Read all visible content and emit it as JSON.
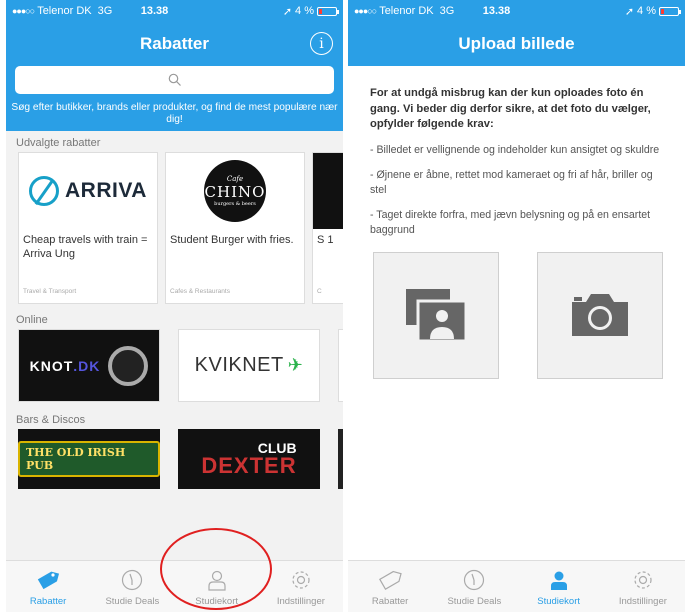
{
  "left": {
    "status": {
      "carrier": "Telenor DK",
      "network": "3G",
      "time": "13.38",
      "battery": "4 %"
    },
    "nav": {
      "title": "Rabatter",
      "info_glyph": "i"
    },
    "search": {
      "placeholder": "",
      "hint": "Søg efter butikker, brands eller produkter, og find de mest populære nær dig!"
    },
    "sections": {
      "featured": "Udvalgte rabatter",
      "online": "Online",
      "bars": "Bars & Discos"
    },
    "featured_cards": [
      {
        "logo": "ARRIVA",
        "title": "Cheap travels with train = Arriva Ung",
        "category": "Travel & Transport"
      },
      {
        "logo_line1": "Cafe",
        "logo_line2": "CHINO",
        "logo_line3": "burgers & beers",
        "title": "Student Burger with fries.",
        "category": "Cafes & Restaurants"
      }
    ],
    "featured_partial": {
      "title": "S 1",
      "category": "C"
    },
    "online_tiles": {
      "knot_prefix": "KNOT",
      "knot_suffix": ".DK",
      "kviknet": "KVIKNET"
    },
    "bar_tiles": {
      "irish": "THE OLD IRISH PUB",
      "club": "CLUB",
      "dexter": "DEXTER"
    },
    "tabs": [
      {
        "label": "Rabatter",
        "icon": "tag-icon",
        "active": true
      },
      {
        "label": "Studie Deals",
        "icon": "clock-icon",
        "active": false
      },
      {
        "label": "Studiekort",
        "icon": "user-icon",
        "active": false
      },
      {
        "label": "Indstillinger",
        "icon": "gear-icon",
        "active": false
      }
    ]
  },
  "right": {
    "status": {
      "carrier": "Telenor DK",
      "network": "3G",
      "time": "13.38",
      "battery": "4 %"
    },
    "nav": {
      "title": "Upload billede"
    },
    "intro": "For at undgå misbrug kan der kun oploades foto én gang. Vi beder dig derfor sikre, at det foto du vælger, opfylder følgende krav:",
    "requirements": [
      "- Billedet er vellignende og indeholder kun ansigtet og skuldre",
      "- Øjnene er åbne, rettet mod kameraet og fri af hår, briller og stel",
      "- Taget direkte forfra, med jævn belysning og på en ensartet baggrund"
    ],
    "tabs": [
      {
        "label": "Rabatter",
        "icon": "tag-icon",
        "active": false
      },
      {
        "label": "Studie Deals",
        "icon": "clock-icon",
        "active": false
      },
      {
        "label": "Studiekort",
        "icon": "user-icon",
        "active": true
      },
      {
        "label": "Indstillinger",
        "icon": "gear-icon",
        "active": false
      }
    ]
  },
  "colors": {
    "accent": "#2a9fe6",
    "highlight": "#e02020"
  }
}
